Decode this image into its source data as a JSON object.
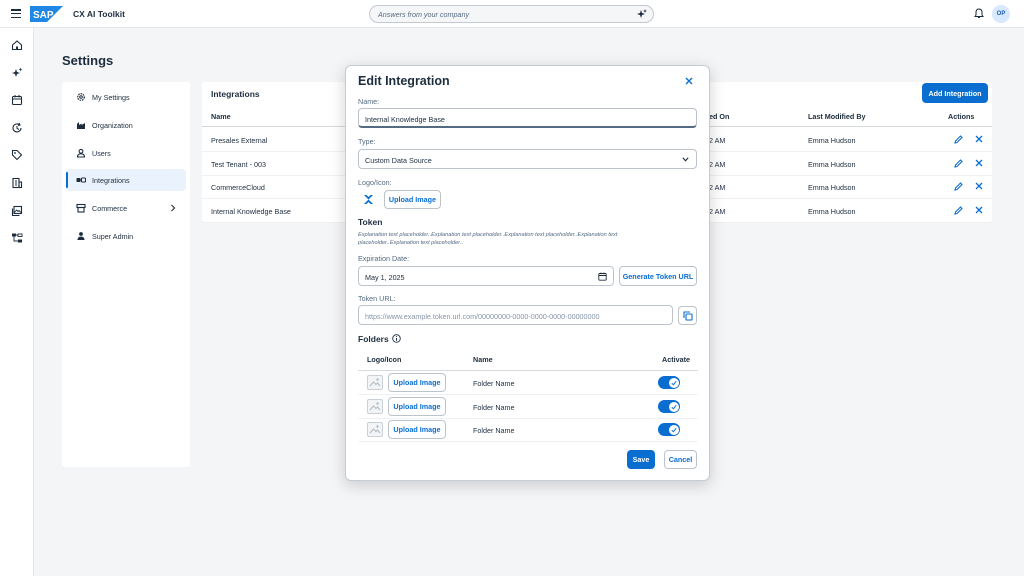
{
  "shell": {
    "app_title": "CX AI Toolkit",
    "logo_text": "SAP",
    "search_placeholder": "Answers from your company",
    "avatar_initials": "OP"
  },
  "sidenav": {
    "icons": [
      "home-icon",
      "ai-sparkle-icon",
      "calendar-icon",
      "refresh-icon",
      "tag-icon",
      "building-icon",
      "image-gallery-icon",
      "org-chart-icon"
    ]
  },
  "page": {
    "title": "Settings"
  },
  "settings_menu": {
    "items": [
      {
        "label": "My Settings",
        "icon": "gear-icon"
      },
      {
        "label": "Organization",
        "icon": "factory-icon"
      },
      {
        "label": "Users",
        "icon": "user-icon"
      },
      {
        "label": "Integrations",
        "icon": "integration-icon",
        "active": true
      },
      {
        "label": "Commerce",
        "icon": "commerce-icon",
        "has_children": true
      },
      {
        "label": "Super Admin",
        "icon": "admin-user-icon"
      }
    ]
  },
  "integrations_table": {
    "title": "Integrations",
    "add_button": "Add Integration",
    "columns": [
      "Name",
      "ed On",
      "Last Modified By",
      "Actions"
    ],
    "rows": [
      {
        "name": "Presales External",
        "modified_on": "2 AM",
        "modified_by": "Emma Hudson"
      },
      {
        "name": "Test Tenant - 003",
        "modified_on": "2 AM",
        "modified_by": "Emma Hudson"
      },
      {
        "name": "CommerceCloud",
        "modified_on": "2 AM",
        "modified_by": "Emma Hudson"
      },
      {
        "name": "Internal Knowledge Base",
        "modified_on": "2 AM",
        "modified_by": "Emma Hudson"
      }
    ]
  },
  "dialog": {
    "title": "Edit Integration",
    "name_label": "Name:",
    "name_value": "Internal Knowledge Base",
    "type_label": "Type:",
    "type_value": "Custom Data Source",
    "logo_label": "Logo/Icon:",
    "upload_image": "Upload Image",
    "token_heading": "Token",
    "token_explanation": "Explanation text placeholder..Explanation text placeholder..Explanation text placeholder..Explanation text placeholder..Explanation text placeholder..",
    "expiration_label": "Expiration Date:",
    "expiration_value": "May 1, 2025",
    "generate_button": "Generate Token URL",
    "token_url_label": "Token URL:",
    "token_url_placeholder": "https://www.example.token.url.com/00000000-0000-0000-0000-00000000",
    "folders_heading": "Folders",
    "folders_columns": [
      "Logo/Icon",
      "Name",
      "Activate"
    ],
    "folders": [
      {
        "upload": "Upload Image",
        "name": "Folder Name",
        "active": true
      },
      {
        "upload": "Upload Image",
        "name": "Folder Name",
        "active": true
      },
      {
        "upload": "Upload Image",
        "name": "Folder Name",
        "active": true
      }
    ],
    "save_button": "Save",
    "cancel_button": "Cancel"
  },
  "colors": {
    "accent": "#0a6ed1",
    "text": "#1d2d3e",
    "background": "#f4f5f7",
    "logo_blue": "#1f88e5"
  }
}
